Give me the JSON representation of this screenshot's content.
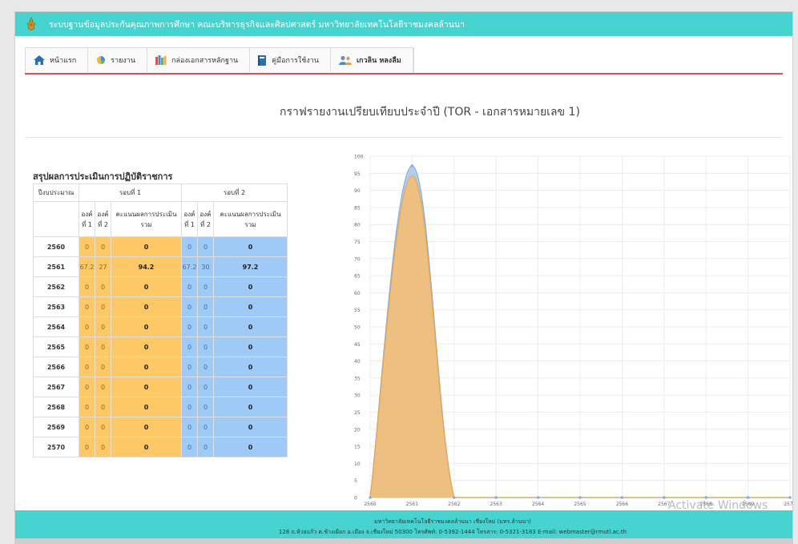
{
  "header": {
    "title": "ระบบฐานข้อมูลประกันคุณภาพการศึกษา คณะบริหารธุรกิจและศิลปศาสตร์ มหาวิทยาลัยเทคโนโลยีราชมงคลล้านนา"
  },
  "nav": {
    "items": [
      {
        "label": "หน้าแรก",
        "icon": "home-icon"
      },
      {
        "label": "รายงาน",
        "icon": "report-icon"
      },
      {
        "label": "กล่องเอกสารหลักฐาน",
        "icon": "books-icon"
      },
      {
        "label": "คู่มือการใช้งาน",
        "icon": "manual-icon"
      },
      {
        "label": "เกวลิน หลงลืม",
        "icon": "user-icon"
      }
    ]
  },
  "page": {
    "title": "กราฟรายงานเปรียบเทียบประจำปี (TOR - เอกสารหมายเลข 1)"
  },
  "table": {
    "heading": "สรุปผลการประเมินการปฏิบัติราชการ",
    "col_year": "ปีงบประมาณ",
    "round1": "รอบที่ 1",
    "round2": "รอบที่ 2",
    "part1": "องค์ที่ 1",
    "part2": "องค์ที่ 2",
    "total": "คะแนนผลการประเมิน รวม",
    "rows": [
      {
        "year": "2560",
        "r1": [
          "0",
          "0",
          "0"
        ],
        "r2": [
          "0",
          "0",
          "0"
        ]
      },
      {
        "year": "2561",
        "r1": [
          "67.2",
          "27",
          "94.2"
        ],
        "r2": [
          "67.2",
          "30",
          "97.2"
        ]
      },
      {
        "year": "2562",
        "r1": [
          "0",
          "0",
          "0"
        ],
        "r2": [
          "0",
          "0",
          "0"
        ]
      },
      {
        "year": "2563",
        "r1": [
          "0",
          "0",
          "0"
        ],
        "r2": [
          "0",
          "0",
          "0"
        ]
      },
      {
        "year": "2564",
        "r1": [
          "0",
          "0",
          "0"
        ],
        "r2": [
          "0",
          "0",
          "0"
        ]
      },
      {
        "year": "2565",
        "r1": [
          "0",
          "0",
          "0"
        ],
        "r2": [
          "0",
          "0",
          "0"
        ]
      },
      {
        "year": "2566",
        "r1": [
          "0",
          "0",
          "0"
        ],
        "r2": [
          "0",
          "0",
          "0"
        ]
      },
      {
        "year": "2567",
        "r1": [
          "0",
          "0",
          "0"
        ],
        "r2": [
          "0",
          "0",
          "0"
        ]
      },
      {
        "year": "2568",
        "r1": [
          "0",
          "0",
          "0"
        ],
        "r2": [
          "0",
          "0",
          "0"
        ]
      },
      {
        "year": "2569",
        "r1": [
          "0",
          "0",
          "0"
        ],
        "r2": [
          "0",
          "0",
          "0"
        ]
      },
      {
        "year": "2570",
        "r1": [
          "0",
          "0",
          "0"
        ],
        "r2": [
          "0",
          "0",
          "0"
        ]
      }
    ]
  },
  "chart_data": {
    "type": "area",
    "categories": [
      "2560",
      "2561",
      "2562",
      "2563",
      "2564",
      "2565",
      "2566",
      "2567",
      "2568",
      "2569",
      "2570"
    ],
    "series": [
      {
        "values": [
          0,
          97.2,
          0,
          0,
          0,
          0,
          0,
          0,
          0,
          0,
          0
        ],
        "color": "#a7c6e6",
        "stroke": "#7fb0e0"
      },
      {
        "values": [
          0,
          94.2,
          0,
          0,
          0,
          0,
          0,
          0,
          0,
          0,
          0
        ],
        "color": "#f0be7a",
        "stroke": "#e8a550"
      }
    ],
    "ylim": [
      0,
      100
    ],
    "yticks": [
      0,
      5,
      10,
      15,
      20,
      25,
      30,
      35,
      40,
      45,
      50,
      55,
      60,
      65,
      70,
      75,
      80,
      85,
      90,
      95,
      100
    ],
    "grid": true
  },
  "footer": {
    "line1": "มหาวิทยาลัยเทคโนโลยีราชมงคลล้านนา เชียงใหม่ (มทร.ล้านนา)",
    "line2": "128 ถ.ห้วยแก้ว ต.ช้างเผือก อ.เมือง จ.เชียงใหม่ 50300 โทรศัพท์: 0-5392-1444 โทรสาร: 0-5321-3183 E-mail: webmaster@rmutl.ac.th"
  },
  "watermark": "Activate Windows",
  "colors": {
    "header_bg": "#47d3cf",
    "round1_cell": "#fec865",
    "round2_cell": "#9fcaf8",
    "nav_underline": "#d9534f"
  }
}
